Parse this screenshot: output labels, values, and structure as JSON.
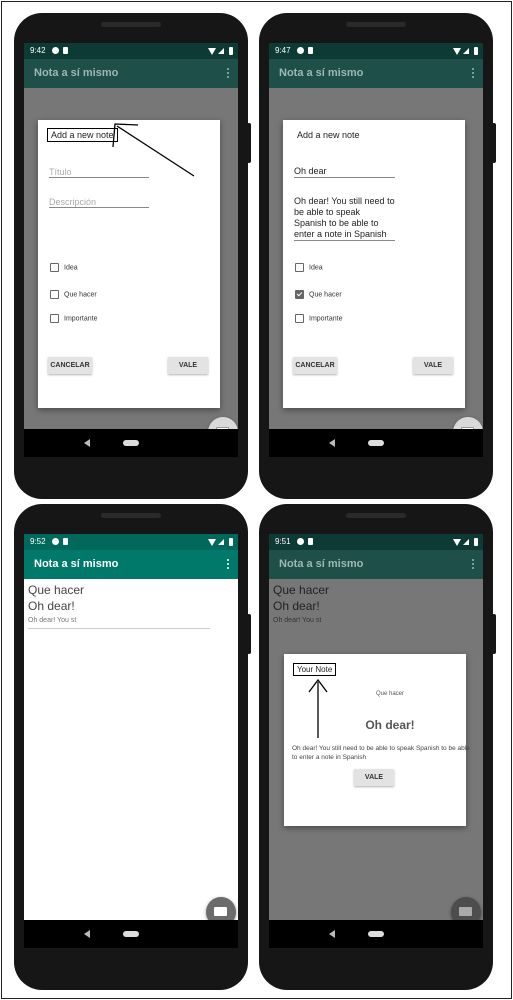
{
  "colors": {
    "appbar": "#00796b",
    "appbar_dimmed": "#1f4f49",
    "dialog_scrim": "rgba(0,0,0,0.5)"
  },
  "status_times": [
    "9:42",
    "9:47",
    "9:52",
    "9:51"
  ],
  "app_title": "Nota a sí mismo",
  "add_dialog": {
    "title": "Add a new note",
    "title_placeholder": "Título",
    "description_placeholder": "Descripción",
    "checkboxes": [
      "Idea",
      "Que hacer",
      "Importante"
    ],
    "cancel": "CANCELAR",
    "ok": "VALE"
  },
  "filled_dialog": {
    "title": "Add a new note",
    "title_value": "Oh dear",
    "description_value": "Oh dear! You still need to be able to speak Spanish to be able to enter a note in Spanish",
    "checked": [
      false,
      true,
      false
    ],
    "cancel": "CANCELAR",
    "ok": "VALE"
  },
  "note_list": {
    "item_type": "Que hacer",
    "item_title": "Oh dear!",
    "item_preview": "Oh dear! You st"
  },
  "view_dialog": {
    "title": "Your Note",
    "type": "Que hacer",
    "note_title": "Oh dear!",
    "body": "Oh dear! You still need to be able to speak Spanish to be able to enter a note in Spanish",
    "ok": "VALE"
  },
  "icons": {
    "fab": "email-icon",
    "gear": "gear-icon",
    "sd": "sd-card-icon",
    "wifi": "wifi-icon",
    "signal": "signal-icon",
    "battery": "battery-icon"
  }
}
